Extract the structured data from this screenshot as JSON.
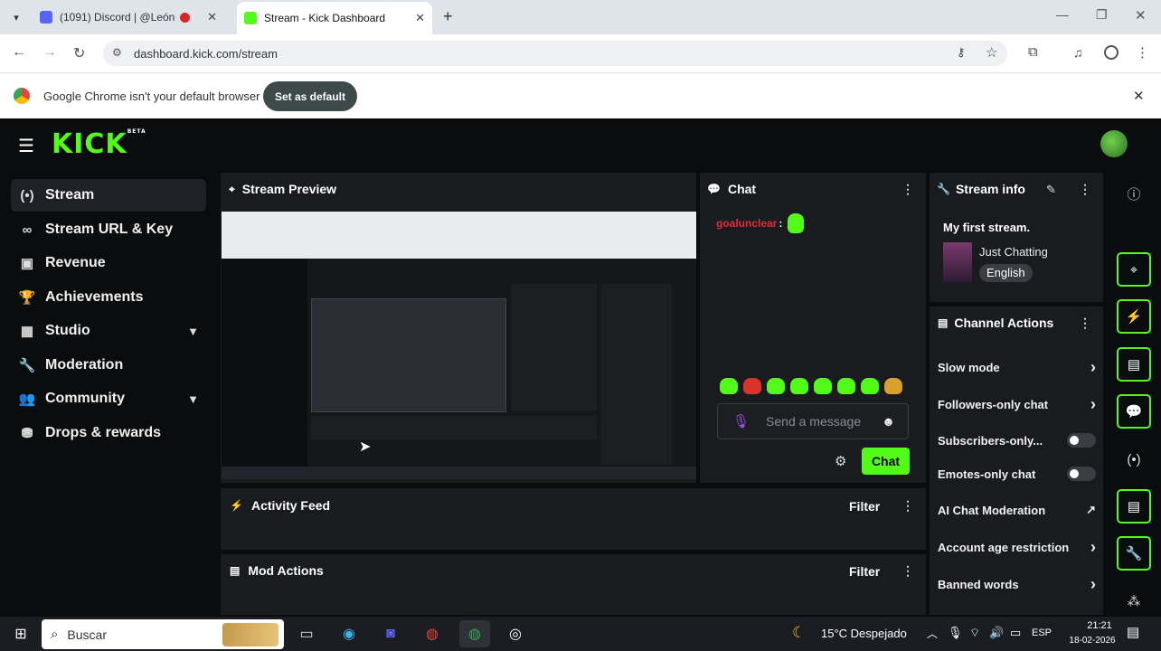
{
  "browser": {
    "tabs": [
      {
        "title": "(1091) Discord | @León"
      },
      {
        "title": "Stream - Kick Dashboard"
      }
    ],
    "url": "dashboard.kick.com/stream",
    "infobar_text": "Google Chrome isn't your default browser",
    "set_default_label": "Set as default"
  },
  "app": {
    "logo": "KICK",
    "logo_badge": "BETA",
    "accent": "#53fc18",
    "sidebar": [
      {
        "label": "Stream",
        "icon": "broadcast-icon"
      },
      {
        "label": "Stream URL & Key",
        "icon": "link-icon"
      },
      {
        "label": "Revenue",
        "icon": "wallet-icon"
      },
      {
        "label": "Achievements",
        "icon": "trophy-icon"
      },
      {
        "label": "Studio",
        "icon": "studio-icon"
      },
      {
        "label": "Moderation",
        "icon": "wrench-icon"
      },
      {
        "label": "Community",
        "icon": "people-icon"
      },
      {
        "label": "Drops & rewards",
        "icon": "gift-icon"
      }
    ],
    "stream_preview_title": "Stream Preview",
    "chat": {
      "title": "Chat",
      "username": "goalunclear",
      "placeholder": "Send a message",
      "send_label": "Chat"
    },
    "stream_info": {
      "title": "Stream info",
      "stream_title": "My first stream.",
      "category": "Just Chatting",
      "language": "English"
    },
    "channel_actions": {
      "title": "Channel Actions",
      "items": [
        {
          "label": "Slow mode",
          "control": "arrow"
        },
        {
          "label": "Followers-only chat",
          "control": "arrow"
        },
        {
          "label": "Subscribers-only...",
          "control": "toggle"
        },
        {
          "label": "Emotes-only chat",
          "control": "toggle"
        },
        {
          "label": "AI Chat Moderation",
          "control": "external"
        },
        {
          "label": "Account age restriction",
          "control": "arrow"
        },
        {
          "label": "Banned words",
          "control": "arrow"
        }
      ]
    },
    "activity_feed": {
      "title": "Activity Feed",
      "filter": "Filter"
    },
    "mod_actions": {
      "title": "Mod Actions",
      "filter": "Filter"
    }
  },
  "taskbar": {
    "search": "Buscar",
    "weather": "15°C Despejado",
    "lang": "ESP",
    "time": "21:21",
    "date": "18-02-2026"
  }
}
